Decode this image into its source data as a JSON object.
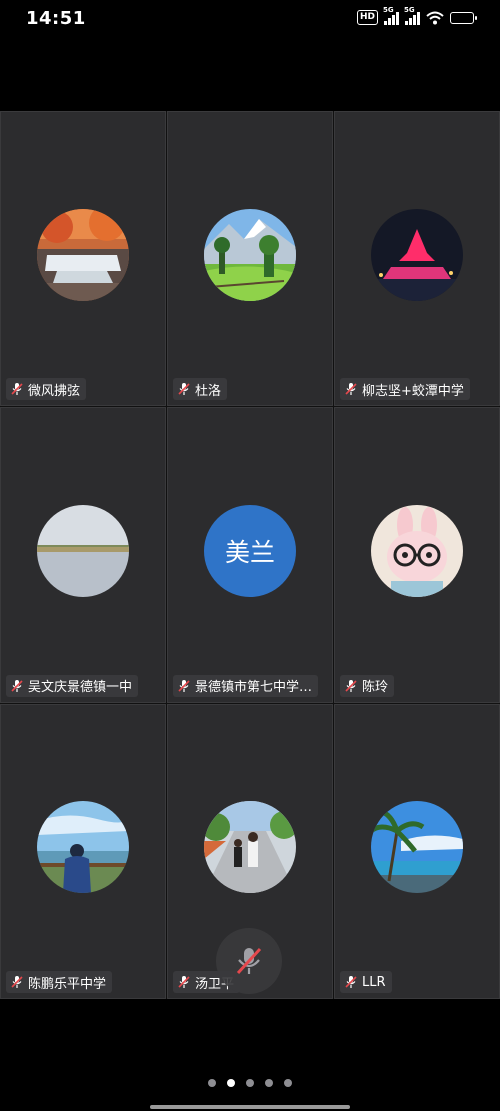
{
  "status_bar": {
    "time": "14:51",
    "hd_label": "HD",
    "signal_1_label": "5G",
    "signal_2_label": "5G",
    "icons": [
      "hd-icon",
      "signal-icon",
      "signal-icon",
      "wifi-icon",
      "battery-icon"
    ]
  },
  "participants": [
    {
      "name": "微风拂弦",
      "muted": true,
      "avatar": "photo-waterfall-autumn"
    },
    {
      "name": "杜洛",
      "muted": true,
      "avatar": "photo-mountain-meadow"
    },
    {
      "name": "柳志坚+蛟潭中学",
      "muted": true,
      "avatar": "photo-night-tower"
    },
    {
      "name": "吴文庆景德镇一中",
      "muted": true,
      "avatar": "photo-lake"
    },
    {
      "name": "景德镇市第七中学…",
      "muted": true,
      "avatar_text": "美兰",
      "avatar_color": "#2f74c8"
    },
    {
      "name": "陈玲",
      "muted": true,
      "avatar": "photo-bunny-glasses"
    },
    {
      "name": "陈鹏乐平中学",
      "muted": true,
      "avatar": "photo-sea-view"
    },
    {
      "name": "汤卫平",
      "muted": true,
      "avatar": "photo-street-walk"
    },
    {
      "name": "LLR",
      "muted": true,
      "avatar": "photo-beach-palm"
    }
  ],
  "floating_mic": {
    "state": "muted",
    "icon": "mic-off-icon"
  },
  "pagination": {
    "pages": 5,
    "current": 2
  }
}
